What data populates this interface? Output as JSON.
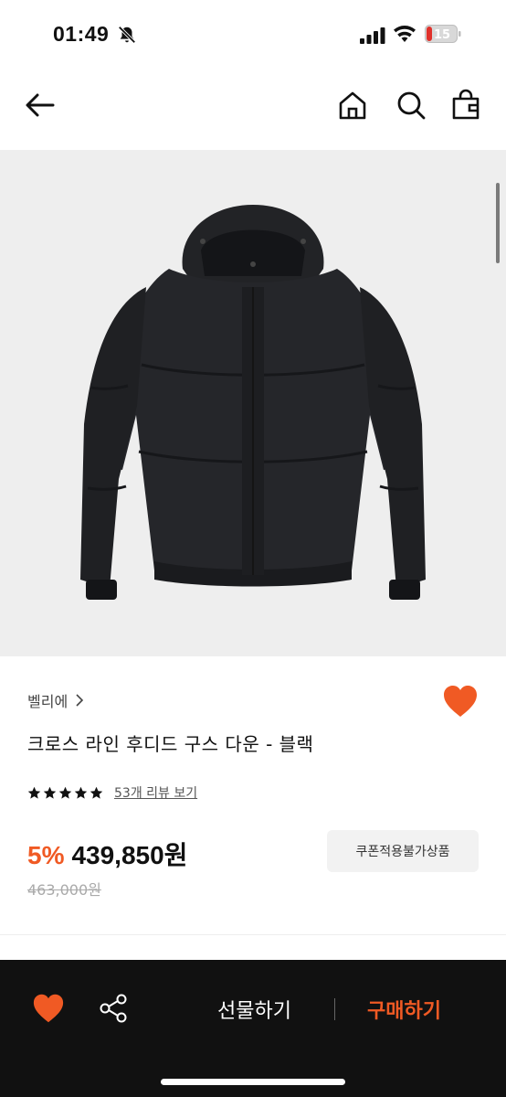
{
  "status_bar": {
    "time": "01:49",
    "battery": "15"
  },
  "header": {
    "icons": [
      "back-arrow-icon",
      "home-icon",
      "search-icon",
      "shopping-bag-icon"
    ]
  },
  "product": {
    "image": "black-hooded-down-jacket",
    "brand": "벨리에",
    "title": "크로스 라인 후디드 구스 다운 - 블랙",
    "rating_stars": 5,
    "review_link": "53개 리뷰 보기",
    "discount": "5%",
    "price": "439,850원",
    "original_price": "463,000원",
    "coupon_label": "쿠폰적용불가상품",
    "favorited": true
  },
  "bottom_bar": {
    "gift_label": "선물하기",
    "buy_label": "구매하기"
  },
  "colors": {
    "accent": "#f05a24",
    "bottom_bar_bg": "#111111",
    "image_bg": "#eeeeee"
  }
}
